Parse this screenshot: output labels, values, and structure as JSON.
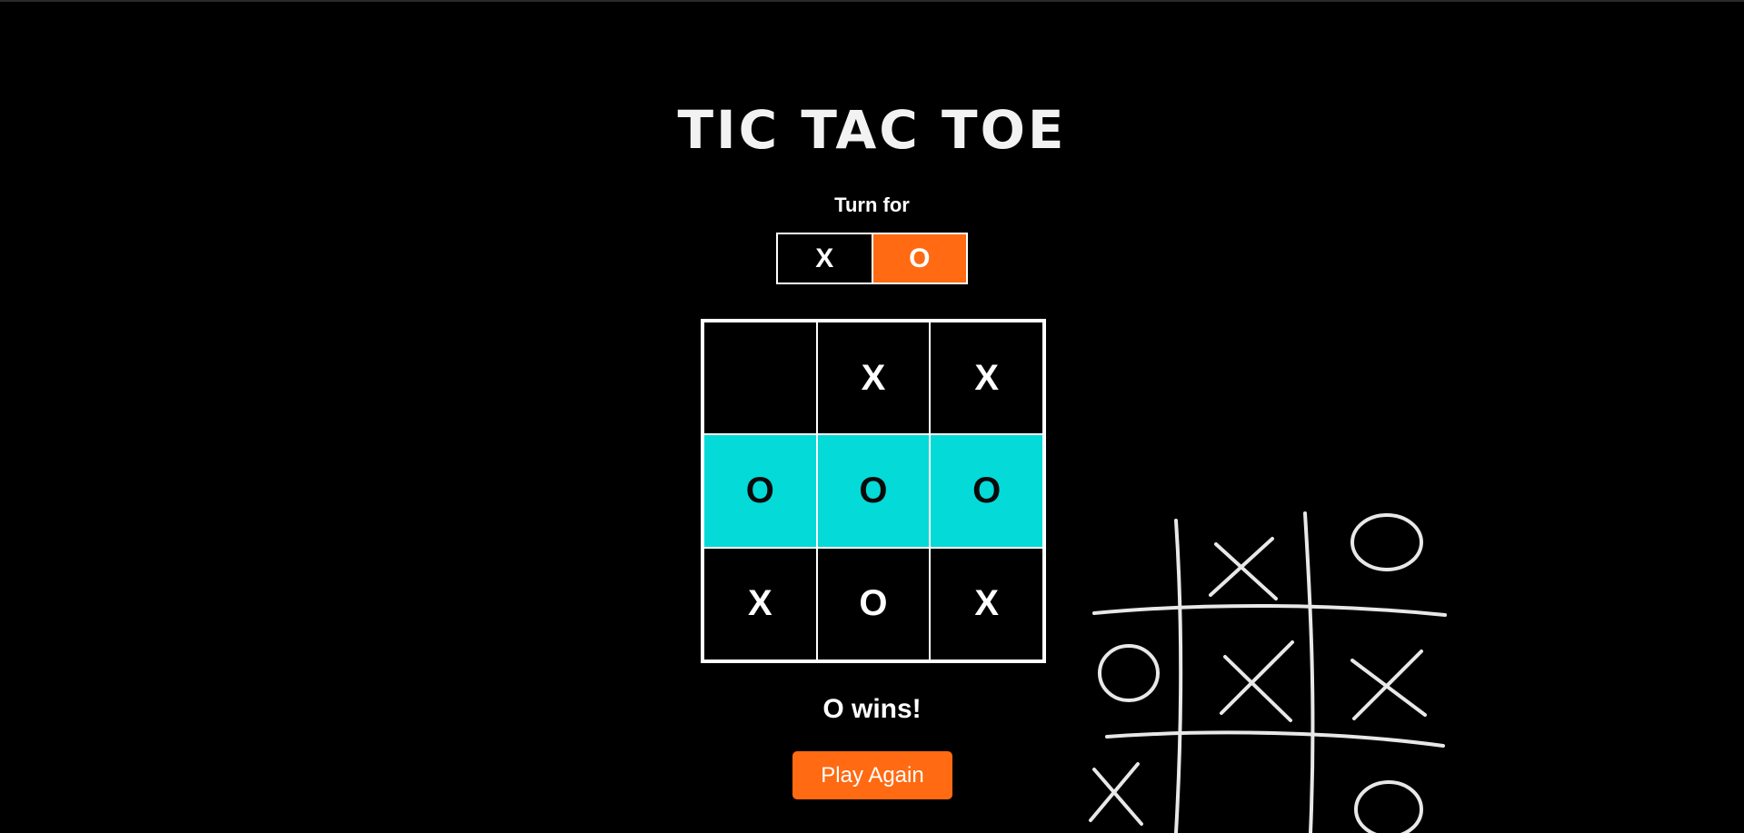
{
  "game": {
    "title": "TIC TAC TOE",
    "turn_label": "Turn for",
    "turn_options": [
      {
        "symbol": "X",
        "active": false
      },
      {
        "symbol": "O",
        "active": true
      }
    ],
    "board": [
      {
        "value": "",
        "winning": false
      },
      {
        "value": "X",
        "winning": false
      },
      {
        "value": "X",
        "winning": false
      },
      {
        "value": "O",
        "winning": true
      },
      {
        "value": "O",
        "winning": true
      },
      {
        "value": "O",
        "winning": true
      },
      {
        "value": "X",
        "winning": false
      },
      {
        "value": "O",
        "winning": false
      },
      {
        "value": "X",
        "winning": false
      }
    ],
    "result": "O wins!",
    "play_again_label": "Play Again"
  },
  "colors": {
    "background": "#000000",
    "accent": "#ff6a12",
    "win_highlight": "#04dad8",
    "text": "#ffffff"
  },
  "decoration": {
    "icon": "chalk-tic-tac-toe-sketch"
  }
}
